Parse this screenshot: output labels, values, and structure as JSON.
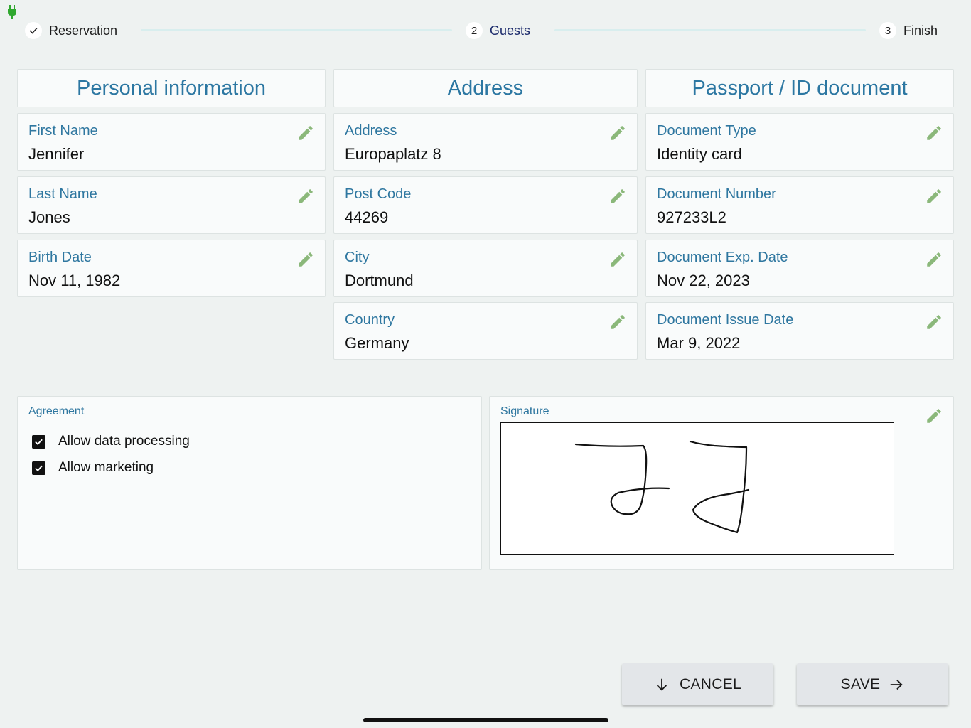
{
  "stepper": {
    "steps": [
      {
        "number": "✓",
        "label": "Reservation"
      },
      {
        "number": "2",
        "label": "Guests"
      },
      {
        "number": "3",
        "label": "Finish"
      }
    ]
  },
  "personal": {
    "title": "Personal information",
    "fields": [
      {
        "label": "First Name",
        "value": "Jennifer"
      },
      {
        "label": "Last Name",
        "value": "Jones"
      },
      {
        "label": "Birth Date",
        "value": "Nov 11, 1982"
      }
    ]
  },
  "address": {
    "title": "Address",
    "fields": [
      {
        "label": "Address",
        "value": "Europaplatz 8"
      },
      {
        "label": "Post Code",
        "value": "44269"
      },
      {
        "label": "City",
        "value": "Dortmund"
      },
      {
        "label": "Country",
        "value": "Germany"
      }
    ]
  },
  "passport": {
    "title": "Passport / ID document",
    "fields": [
      {
        "label": "Document Type",
        "value": "Identity card"
      },
      {
        "label": "Document Number",
        "value": "927233L2"
      },
      {
        "label": "Document Exp. Date",
        "value": "Nov 22, 2023"
      },
      {
        "label": "Document Issue Date",
        "value": "Mar 9, 2022"
      }
    ]
  },
  "agreement": {
    "label": "Agreement",
    "items": [
      {
        "label": "Allow data processing",
        "checked": true
      },
      {
        "label": "Allow marketing",
        "checked": true
      }
    ]
  },
  "signature": {
    "label": "Signature"
  },
  "actions": {
    "cancel_label": "CANCEL",
    "save_label": "SAVE"
  },
  "icons": {
    "status": "plug-icon",
    "edit": "pencil-icon",
    "cancel": "arrow-down-icon",
    "save": "arrow-right-icon",
    "checkbox": "check-icon"
  },
  "colors": {
    "accent": "#2c77a2",
    "edit_icon": "#8bb87a",
    "plug": "#2fa82f",
    "background": "#eef2f1"
  }
}
